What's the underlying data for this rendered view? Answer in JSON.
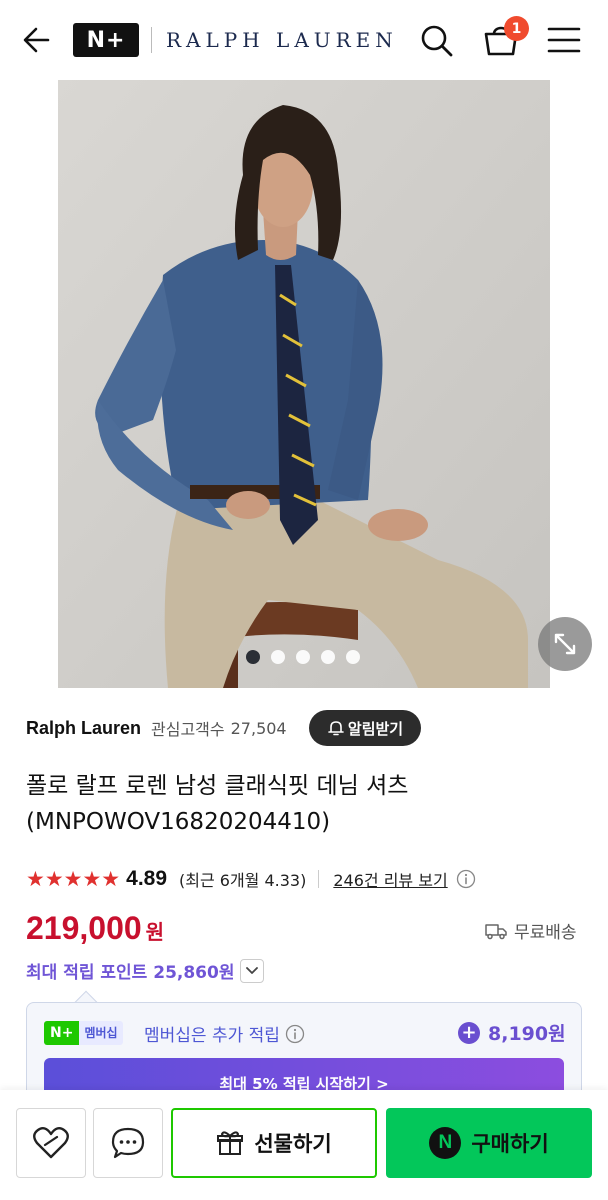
{
  "header": {
    "nplus_logo": "N+",
    "brand_logo": "RALPH LAUREN",
    "cart_count": "1",
    "icons": [
      "arrow-left-icon",
      "search-icon",
      "cart-icon",
      "menu-icon"
    ]
  },
  "gallery": {
    "total_images": 5,
    "active_index": 0
  },
  "product": {
    "brand": "Ralph Lauren",
    "followers_label": "관심고객수",
    "followers_count": "27,504",
    "alarm_label": "알림받기",
    "title_line1": "폴로 랄프 로렌 남성 클래식핏 데님 셔츠",
    "title_line2": "(MNPOWOV16820204410)",
    "stars": "★★★★★",
    "rating": "4.89",
    "recent_rating": "(최근 6개월 4.33)",
    "review_link": "246건 리뷰 보기",
    "price": "219,000",
    "currency": "원",
    "shipping": "무료배송",
    "max_points": "최대 적립 포인트 25,860원"
  },
  "membership": {
    "badge_np": "N+",
    "badge_label": "멤버십",
    "text": "멤버십은 추가 적립",
    "bonus": "8,190원",
    "cta": "최대 5% 적립 시작하기 >"
  },
  "bottom_bar": {
    "gift_label": "선물하기",
    "buy_label": "구매하기",
    "buy_icon_letter": "N"
  },
  "colors": {
    "price_red": "#c8102e",
    "naver_green": "#03c75a",
    "points_purple": "#6f55d6",
    "star_red": "#e0312f"
  }
}
